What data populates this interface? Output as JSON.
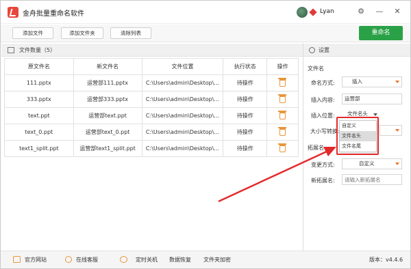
{
  "app": {
    "title": "金舟批量重命名软件",
    "user": "Lyan"
  },
  "window_controls": {
    "settings": "⚙",
    "minimize": "—",
    "close": "✕"
  },
  "toolbar": {
    "add_file": "添加文件",
    "add_folder": "添加文件夹",
    "clear_list": "清除列表",
    "rename": "重命名"
  },
  "file_list": {
    "title": "文件数量（5）",
    "columns": [
      "原文件名",
      "新文件名",
      "文件位置",
      "执行状态",
      "操作"
    ],
    "rows": [
      [
        "111.pptx",
        "运营部111.pptx",
        "C:\\Users\\admin\\Desktop\\...",
        "待操作"
      ],
      [
        "333.pptx",
        "运营部333.pptx",
        "C:\\Users\\admin\\Desktop\\...",
        "待操作"
      ],
      [
        "text.ppt",
        "运营部text.ppt",
        "C:\\Users\\admin\\Desktop\\...",
        "待操作"
      ],
      [
        "text_0.ppt",
        "运营部text_0.ppt",
        "C:\\Users\\admin\\Desktop\\...",
        "待操作"
      ],
      [
        "text1_split.ppt",
        "运营部text1_split.ppt",
        "C:\\Users\\admin\\Desktop\\...",
        "待操作"
      ]
    ]
  },
  "settings": {
    "title": "设置",
    "section_filename": "文件名",
    "naming_mode_label": "命名方式:",
    "naming_mode_value": "插入",
    "insert_content_label": "插入内容:",
    "insert_content_value": "运营部",
    "insert_position_label": "插入位置:",
    "insert_position_value": "文件名头",
    "case_label": "大小写转换:",
    "ext_section": "拓展名",
    "change_mode_label": "变更方式:",
    "change_mode_value": "自定义",
    "new_ext_label": "新拓展名:",
    "new_ext_placeholder": "请输入新拓展名",
    "position_options": [
      "自定义",
      "文件名头",
      "文件名尾"
    ],
    "selected_option": "文件名头"
  },
  "statusbar": {
    "website": "官方网站",
    "support": "在线客服",
    "shutdown": "定时关机",
    "recovery": "数据恢复",
    "encrypt": "文件夹加密",
    "version": "版本：v4.4.6"
  },
  "colors": {
    "accent_green": "#2aa147",
    "highlight_red": "#e32a2a",
    "icon_orange": "#e8963a"
  }
}
